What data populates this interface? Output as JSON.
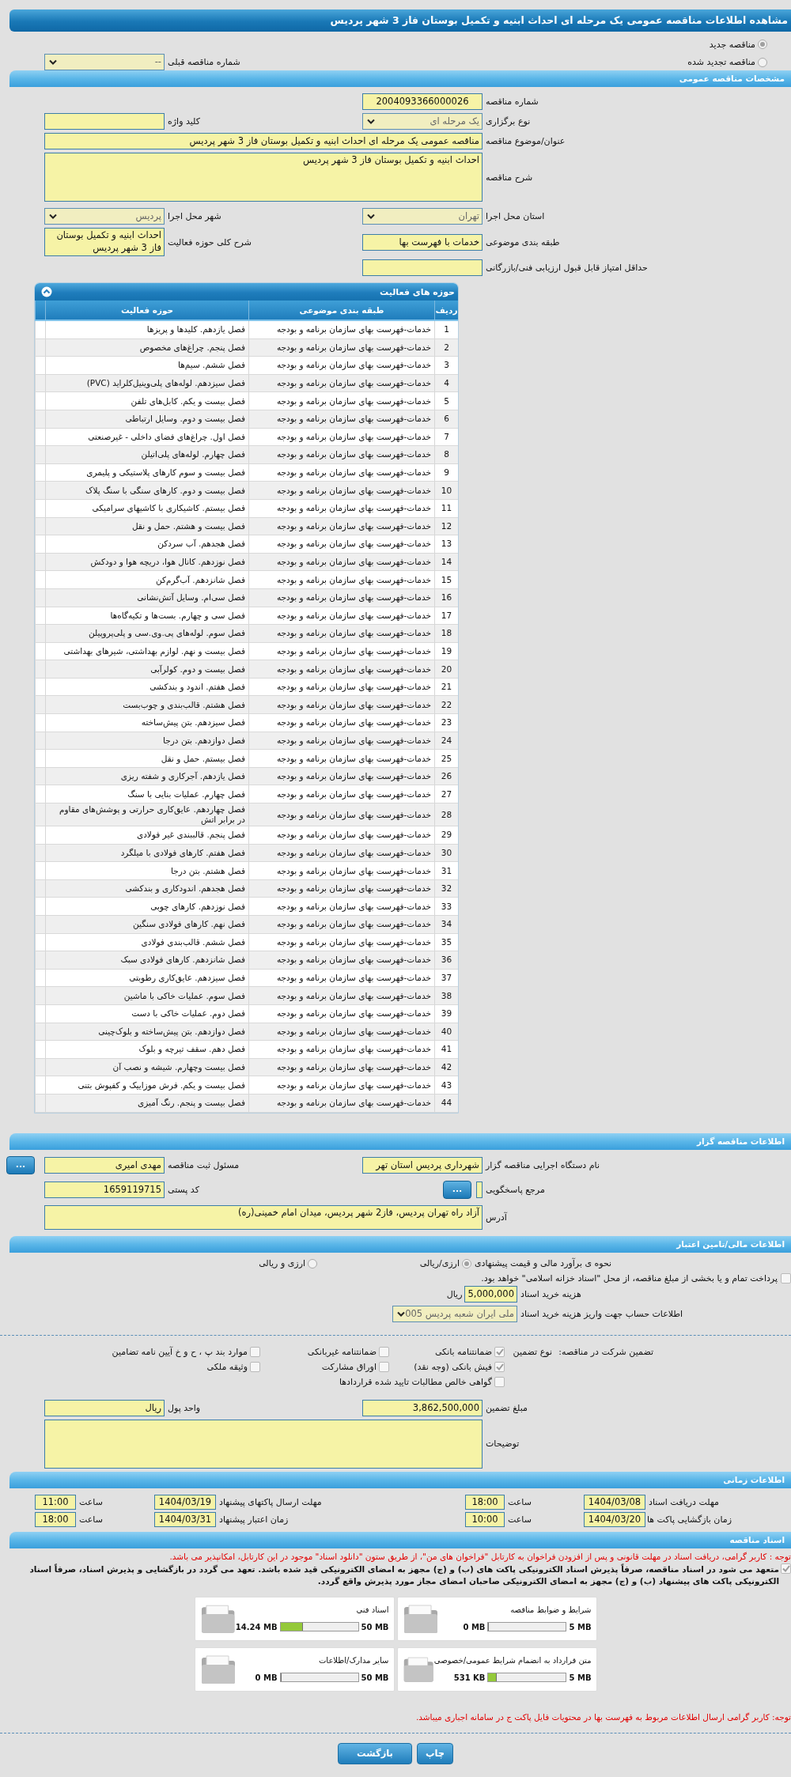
{
  "title": "مشاهده اطلاعات مناقصه عمومی یک مرحله ای احداث ابنیه و تکمیل بوستان فاز 3 شهر پردیس",
  "tender_mode": [
    {
      "label": "مناقصه جدید",
      "selected": true
    },
    {
      "label": "مناقصه تجدید شده",
      "selected": false
    }
  ],
  "previous_tender": {
    "label": "شماره مناقصه قبلی",
    "value": "--"
  },
  "general": {
    "heading": "مشخصات مناقصه عمومی",
    "tender_number": {
      "label": "شماره مناقصه",
      "value": "2004093366000026"
    },
    "holding_type": {
      "label": "نوع برگزاری",
      "value": "یک مرحله ای"
    },
    "keyword": {
      "label": "کلید واژه"
    },
    "subject": {
      "label": "عنوان/موضوع مناقصه",
      "value": "مناقصه عمومی یک مرحله ای احداث ابنیه و تکمیل بوستان فاز 3 شهر پردیس"
    },
    "description": {
      "label": "شرح مناقصه",
      "value": "احداث ابنیه و تکمیل بوستان فاز 3 شهر پردیس"
    },
    "province": {
      "label": "استان محل اجرا",
      "value": "تهران"
    },
    "city": {
      "label": "شهر محل اجرا",
      "value": "پردیس"
    },
    "classification": {
      "label": "طبقه بندی موضوعی",
      "value": "خدمات با فهرست بها"
    },
    "activity_summary": {
      "label": "شرح کلی حوزه فعالیت",
      "value": "احداث ابنیه و تکمیل بوستان فاز 3 شهر پردیس"
    },
    "min_score": {
      "label": "حداقل امتیاز قابل قبول ارزیابی فنی/بازرگانی"
    }
  },
  "activities": {
    "heading": "حوزه های فعالیت",
    "columns": [
      "ردیف",
      "طبقه بندی موضوعی",
      "حوزه فعالیت"
    ],
    "rows": [
      {
        "row": "1",
        "category": "خدمات-فهرست بهای سازمان برنامه و بودجه",
        "activity": "فصل یازدهم. کلیدها و پریزها"
      },
      {
        "row": "2",
        "category": "خدمات-فهرست بهای سازمان برنامه و بودجه",
        "activity": "فصل پنجم. چراغ‌های مخصوص"
      },
      {
        "row": "3",
        "category": "خدمات-فهرست بهای سازمان برنامه و بودجه",
        "activity": "فصل ششم. سیم‌ها"
      },
      {
        "row": "4",
        "category": "خدمات-فهرست بهای سازمان برنامه و بودجه",
        "activity": "فصل سیزدهم. لوله‌های پلی‌وینیل‌کلراید (PVC)"
      },
      {
        "row": "5",
        "category": "خدمات-فهرست بهای سازمان برنامه و بودجه",
        "activity": "فصل بیست و یکم. کابل‌های تلفن"
      },
      {
        "row": "6",
        "category": "خدمات-فهرست بهای سازمان برنامه و بودجه",
        "activity": "فصل بیست و دوم. وسایل ارتباطی"
      },
      {
        "row": "7",
        "category": "خدمات-فهرست بهای سازمان برنامه و بودجه",
        "activity": "فصل اول. چراغ‌های فضای داخلی - غیرصنعتی"
      },
      {
        "row": "8",
        "category": "خدمات-فهرست بهای سازمان برنامه و بودجه",
        "activity": "فصل چهارم. لوله‌های پلی‌اتیلن"
      },
      {
        "row": "9",
        "category": "خدمات-فهرست بهای سازمان برنامه و بودجه",
        "activity": "فصل بیست و سوم کارهای پلاستیکی و پلیمری"
      },
      {
        "row": "10",
        "category": "خدمات-فهرست بهای سازمان برنامه و بودجه",
        "activity": "فصل بیست و دوم. کارهای سنگی با سنگ پلاک"
      },
      {
        "row": "11",
        "category": "خدمات-فهرست بهای سازمان برنامه و بودجه",
        "activity": "فصل بیستم. کاشیکاری با کاشیهای سرامیکی"
      },
      {
        "row": "12",
        "category": "خدمات-فهرست بهای سازمان برنامه و بودجه",
        "activity": "فصل بیست و هشتم. حمل و نقل"
      },
      {
        "row": "13",
        "category": "خدمات-فهرست بهای سازمان برنامه و بودجه",
        "activity": "فصل هجدهم. آب سردکن"
      },
      {
        "row": "14",
        "category": "خدمات-فهرست بهای سازمان برنامه و بودجه",
        "activity": "فصل نوزدهم. کانال هوا، دریچه هوا و دودکش"
      },
      {
        "row": "15",
        "category": "خدمات-فهرست بهای سازمان برنامه و بودجه",
        "activity": "فصل شانزدهم. آب‌گرم‌کن"
      },
      {
        "row": "16",
        "category": "خدمات-فهرست بهای سازمان برنامه و بودجه",
        "activity": "فصل سی‌ام. وسایل آتش‌نشانی"
      },
      {
        "row": "17",
        "category": "خدمات-فهرست بهای سازمان برنامه و بودجه",
        "activity": "فصل سی و چهارم. بست‌ها و تکیه‌گاه‌ها"
      },
      {
        "row": "18",
        "category": "خدمات-فهرست بهای سازمان برنامه و بودجه",
        "activity": "فصل سوم. لوله‌های پی.وی.سی و پلی‌پروپیلن"
      },
      {
        "row": "19",
        "category": "خدمات-فهرست بهای سازمان برنامه و بودجه",
        "activity": "فصل بیست و نهم. لوازم بهداشتی، شیرهای بهداشتی"
      },
      {
        "row": "20",
        "category": "خدمات-فهرست بهای سازمان برنامه و بودجه",
        "activity": "فصل بیست و دوم. کولرآبی"
      },
      {
        "row": "21",
        "category": "خدمات-فهرست بهای سازمان برنامه و بودجه",
        "activity": "فصل هفتم. اندود و بندکشی"
      },
      {
        "row": "22",
        "category": "خدمات-فهرست بهای سازمان برنامه و بودجه",
        "activity": "فصل هشتم. قالب‌بندی و چوب‌بست"
      },
      {
        "row": "23",
        "category": "خدمات-فهرست بهای سازمان برنامه و بودجه",
        "activity": "فصل سیزدهم. بتن پیش‌ساخته"
      },
      {
        "row": "24",
        "category": "خدمات-فهرست بهای سازمان برنامه و بودجه",
        "activity": "فصل دوازدهم. بتن درجا"
      },
      {
        "row": "25",
        "category": "خدمات-فهرست بهای سازمان برنامه و بودجه",
        "activity": "فصل بیستم. حمل و نقل"
      },
      {
        "row": "26",
        "category": "خدمات-فهرست بهای سازمان برنامه و بودجه",
        "activity": "فصل یازدهم. آجرکاری و شفته ریزی"
      },
      {
        "row": "27",
        "category": "خدمات-فهرست بهای سازمان برنامه و بودجه",
        "activity": "فصل چهارم. عملیات بنایی با سنگ"
      },
      {
        "row": "28",
        "category": "خدمات-فهرست بهای سازمان برنامه و بودجه",
        "activity": "فصل چهاردهم. عایق‌کاری حرارتی و پوشش‌های مقاوم در برابر اتش"
      },
      {
        "row": "29",
        "category": "خدمات-فهرست بهای سازمان برنامه و بودجه",
        "activity": "فصل پنجم. قالببندی غیر فولادی"
      },
      {
        "row": "30",
        "category": "خدمات-فهرست بهای سازمان برنامه و بودجه",
        "activity": "فصل هفتم. کارهای فولادی با میلگرد"
      },
      {
        "row": "31",
        "category": "خدمات-فهرست بهای سازمان برنامه و بودجه",
        "activity": "فصل هشتم. بتن درجا"
      },
      {
        "row": "32",
        "category": "خدمات-فهرست بهای سازمان برنامه و بودجه",
        "activity": "فصل هجدهم. اندودکاری و بندکشی"
      },
      {
        "row": "33",
        "category": "خدمات-فهرست بهای سازمان برنامه و بودجه",
        "activity": "فصل نوزدهم. کارهای چوبی"
      },
      {
        "row": "34",
        "category": "خدمات-فهرست بهای سازمان برنامه و بودجه",
        "activity": "فصل نهم. کارهای فولادی سنگین"
      },
      {
        "row": "35",
        "category": "خدمات-فهرست بهای سازمان برنامه و بودجه",
        "activity": "فصل ششم. قالب‌بندی فولادی"
      },
      {
        "row": "36",
        "category": "خدمات-فهرست بهای سازمان برنامه و بودجه",
        "activity": "فصل شانزدهم. کارهای فولادی سبک"
      },
      {
        "row": "37",
        "category": "خدمات-فهرست بهای سازمان برنامه و بودجه",
        "activity": "فصل سیزدهم. عایق‌کاری رطوبتی"
      },
      {
        "row": "38",
        "category": "خدمات-فهرست بهای سازمان برنامه و بودجه",
        "activity": "فصل سوم. عملیات خاکی با ماشین"
      },
      {
        "row": "39",
        "category": "خدمات-فهرست بهای سازمان برنامه و بودجه",
        "activity": "فصل دوم. عملیات خاکی با دست"
      },
      {
        "row": "40",
        "category": "خدمات-فهرست بهای سازمان برنامه و بودجه",
        "activity": "فصل دوازدهم. بتن پیش‌ساخته و بلوک‌چینی"
      },
      {
        "row": "41",
        "category": "خدمات-فهرست بهای سازمان برنامه و بودجه",
        "activity": "فصل دهم. سقف تیرچه و بلوک"
      },
      {
        "row": "42",
        "category": "خدمات-فهرست بهای سازمان برنامه و بودجه",
        "activity": "فصل بیست وچهارم. شیشه و نصب آن"
      },
      {
        "row": "43",
        "category": "خدمات-فهرست بهای سازمان برنامه و بودجه",
        "activity": "فصل بیست و یکم. فرش موزاییک و کفپوش بتنی"
      },
      {
        "row": "44",
        "category": "خدمات-فهرست بهای سازمان برنامه و بودجه",
        "activity": "فصل بیست و پنجم. رنگ آمیزی"
      }
    ]
  },
  "organizer": {
    "heading": "اطلاعات مناقصه گزار",
    "agency": {
      "label": "نام دستگاه اجرایی مناقصه گزار",
      "value": "شهرداری پردیس استان تهر"
    },
    "registrar": {
      "label": "مسئول ثبت مناقصه",
      "value": "مهدی امیری",
      "button": "..."
    },
    "reference": {
      "label": "مرجع پاسخگویی",
      "button": "..."
    },
    "postal_code": {
      "label": "کد پستی",
      "value": "1659119715"
    },
    "address": {
      "label": "آدرس",
      "value": "آزاد راه تهران پردیس، فاز2 شهر پردیس، میدان امام خمینی(ره)"
    }
  },
  "financial": {
    "heading": "اطلاعات مالی/تامین اعتبار",
    "estimate": {
      "label": "نحوه ی برآورد مالی و قیمت پیشنهادی",
      "options": [
        {
          "label": "ارزی/ریالی",
          "selected": true
        },
        {
          "label": "ارزی و ریالی",
          "selected": false
        }
      ]
    },
    "treasury": {
      "label": "پرداخت تمام و یا بخشی از مبلغ مناقصه، از محل \"اسناد خزانه اسلامی\" خواهد بود.",
      "checked": false
    },
    "document_fee": {
      "label": "هزینه خرید اسناد",
      "value": "5,000,000",
      "unit": "ریال"
    },
    "account": {
      "label": "اطلاعات حساب جهت واریز هزینه خرید اسناد",
      "value": "ملی ایران شعبه پردیس 005"
    },
    "guarantee": {
      "label": "تضمین شرکت در مناقصه:",
      "type_label": "نوع تضمین",
      "options": [
        {
          "label": "ضمانتنامه بانکی",
          "checked": true
        },
        {
          "label": "ضمانتنامه غیربانکی",
          "checked": false
        },
        {
          "label": "موارد بند پ ، ح و خ آیین نامه تضامین",
          "checked": false
        },
        {
          "label": "فیش بانکی (وجه نقد)",
          "checked": true
        },
        {
          "label": "اوراق مشارکت",
          "checked": false
        },
        {
          "label": "وثیقه ملکی",
          "checked": false
        },
        {
          "label": "گواهی خالص مطالبات تایید شده قراردادها",
          "checked": false
        }
      ]
    },
    "amount": {
      "label": "مبلغ تضمین",
      "value": "3,862,500,000"
    },
    "currency": {
      "label": "واحد پول",
      "value": "ریال"
    },
    "notes": {
      "label": "توضیحات"
    }
  },
  "schedule": {
    "heading": "اطلاعات زمانی",
    "items": [
      {
        "label": "مهلت دریافت اسناد",
        "date": "1404/03/08",
        "time_label": "ساعت",
        "time": "18:00"
      },
      {
        "label": "مهلت ارسال پاکتهای پیشنهاد",
        "date": "1404/03/19",
        "time_label": "ساعت",
        "time": "11:00"
      },
      {
        "label": "زمان بازگشایی پاکت ها",
        "date": "1404/03/20",
        "time_label": "ساعت",
        "time": "10:00"
      },
      {
        "label": "زمان اعتبار پیشنهاد",
        "date": "1404/03/31",
        "time_label": "ساعت",
        "time": "18:00"
      }
    ]
  },
  "documents": {
    "heading": "اسناد مناقصه",
    "notice": "توجه : کاربر گرامی، دریافت اسناد در مهلت قانونی و پس از افزودن فراخوان به کارتابل \"فراخوان های من\"، از طریق ستون \"دانلود اسناد\" موجود در این کارتابل، امکانپذیر می باشد.",
    "commitment": {
      "text": "متعهد می شود در اسناد مناقصه، صرفاً پذیرش اسناد الکترونیکی پاکت های (ب) و (ج) مجهز به امضای الکترونیکی قید شده باشد. تعهد می گردد در بازگشایی و پذیرش اسناد، صرفاً اسناد الکترونیکی پاکت های پیشنهاد (ب) و (ج) مجهز به امضای الکترونیکی صاحبان امضای مجاز مورد پذیرش واقع گردد.",
      "checked": true
    },
    "files": [
      {
        "name": "شرایط و ضوابط مناقصه",
        "used": "0 MB",
        "limit": "5 MB",
        "level": 0
      },
      {
        "name": "اسناد فنی",
        "used": "14.24 MB",
        "limit": "50 MB",
        "level": 0.285
      },
      {
        "name": "متن قرارداد به انضمام شرایط عمومی/خصوصی",
        "used": "531 KB",
        "limit": "5 MB",
        "level": 0.1
      },
      {
        "name": "سایر مدارک/اطلاعات",
        "used": "0 MB",
        "limit": "50 MB",
        "level": 0
      }
    ],
    "footnote": "توجه: کاربر گرامی ارسال اطلاعات مربوط به فهرست بها در محتویات فایل پاکت ج در سامانه اجباری میباشد."
  },
  "buttons": [
    "چاپ",
    "بازگشت"
  ]
}
